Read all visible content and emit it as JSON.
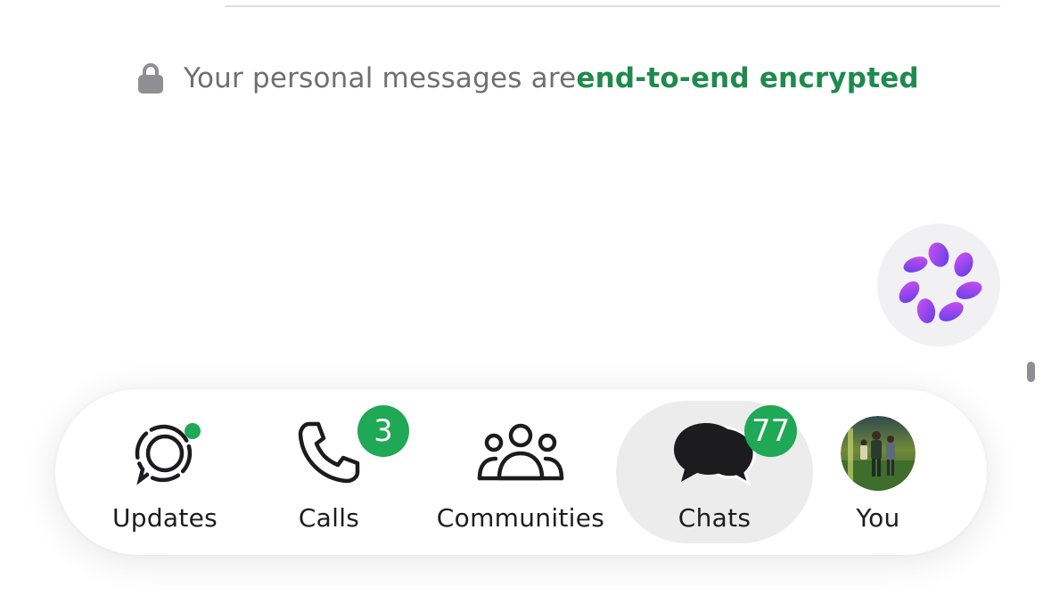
{
  "encryption": {
    "prefix": "Your personal messages are ",
    "link": "end-to-end encrypted",
    "icon": "lock-icon"
  },
  "meta_ai": {
    "icon": "meta-ai-icon"
  },
  "tabs": [
    {
      "id": "updates",
      "label": "Updates",
      "icon": "updates-icon",
      "has_dot": true
    },
    {
      "id": "calls",
      "label": "Calls",
      "icon": "phone-icon",
      "badge": "3"
    },
    {
      "id": "communities",
      "label": "Communities",
      "icon": "communities-icon"
    },
    {
      "id": "chats",
      "label": "Chats",
      "icon": "chats-icon",
      "badge": "77",
      "active": true
    },
    {
      "id": "you",
      "label": "You",
      "icon": "avatar"
    }
  ],
  "colors": {
    "accent": "#1f8a4c",
    "badge": "#1fa855",
    "active_tab_bg": "#ececec"
  }
}
